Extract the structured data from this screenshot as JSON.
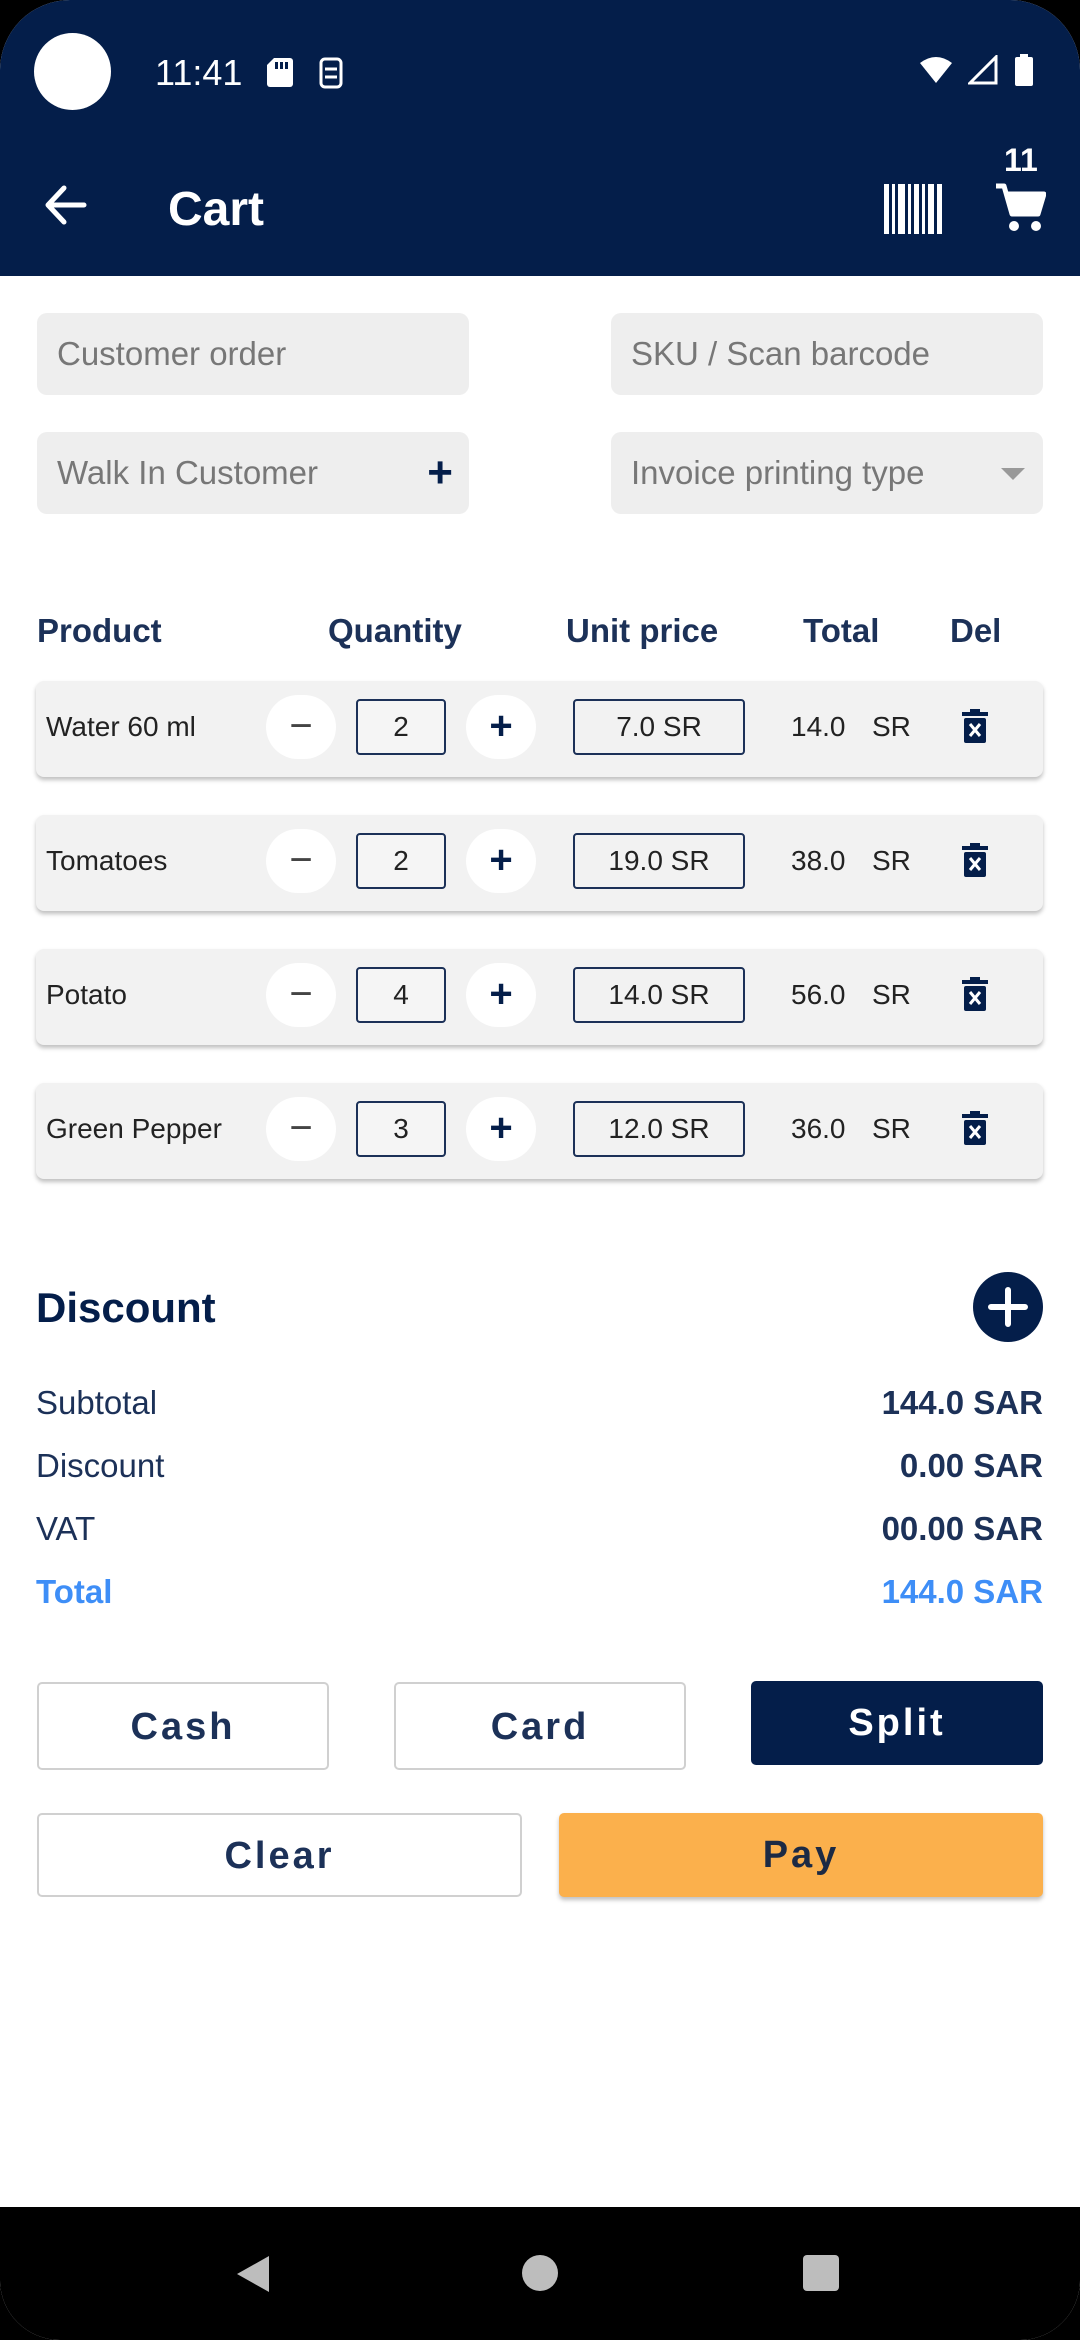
{
  "status_bar": {
    "time": "11:41"
  },
  "header": {
    "title": "Cart",
    "cart_count": "11"
  },
  "inputs": {
    "customer_order_placeholder": "Customer order",
    "sku_placeholder": "SKU / Scan barcode",
    "customer_value": "Walk In Customer",
    "invoice_type_placeholder": "Invoice printing type"
  },
  "table": {
    "headers": [
      "Product",
      "Quantity",
      "Unit price",
      "Total",
      "Del"
    ],
    "rows": [
      {
        "name": "Water 60 ml",
        "qty": "2",
        "price": "7.0 SR",
        "total": "14.0",
        "currency": "SR"
      },
      {
        "name": "Tomatoes",
        "qty": "2",
        "price": "19.0 SR",
        "total": "38.0",
        "currency": "SR"
      },
      {
        "name": "Potato",
        "qty": "4",
        "price": "14.0 SR",
        "total": "56.0",
        "currency": "SR"
      },
      {
        "name": "Green Pepper",
        "qty": "3",
        "price": "12.0 SR",
        "total": "36.0",
        "currency": "SR"
      }
    ]
  },
  "summary": {
    "discount_title": "Discount",
    "subtotal_label": "Subtotal",
    "subtotal_value": "144.0 SAR",
    "discount_label": "Discount",
    "discount_value": "0.00 SAR",
    "vat_label": "VAT",
    "vat_value": "00.00 SAR",
    "total_label": "Total",
    "total_value": "144.0 SAR"
  },
  "actions": {
    "cash": "Cash",
    "card": "Card",
    "split": "Split",
    "clear": "Clear",
    "pay": "Pay"
  },
  "colors": {
    "primary": "#041e4a",
    "accent": "#fbb04c",
    "total_blue": "#3e8ef7"
  }
}
